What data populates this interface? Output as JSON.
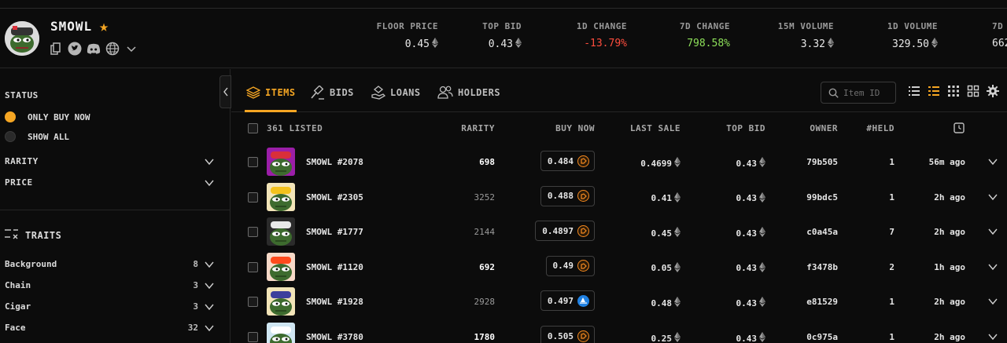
{
  "collection": {
    "name": "SMOWL",
    "favorite": true
  },
  "stats": [
    {
      "label": "FLOOR PRICE",
      "value": "0.45",
      "eth": true,
      "tone": "neutral"
    },
    {
      "label": "TOP BID",
      "value": "0.43",
      "eth": true,
      "tone": "neutral"
    },
    {
      "label": "1D CHANGE",
      "value": "-13.79%",
      "eth": false,
      "tone": "neg"
    },
    {
      "label": "7D CHANGE",
      "value": "798.58%",
      "eth": false,
      "tone": "pos"
    },
    {
      "label": "15M VOLUME",
      "value": "3.32",
      "eth": true,
      "tone": "neutral"
    },
    {
      "label": "1D VOLUME",
      "value": "329.50",
      "eth": true,
      "tone": "neutral"
    },
    {
      "label": "7D",
      "value": "662",
      "eth": false,
      "tone": "neutral"
    }
  ],
  "sidebar": {
    "status_title": "STATUS",
    "status_options": [
      {
        "label": "ONLY BUY NOW",
        "selected": true
      },
      {
        "label": "SHOW ALL",
        "selected": false
      }
    ],
    "filters": [
      {
        "label": "RARITY"
      },
      {
        "label": "PRICE"
      }
    ],
    "traits_title": "TRAITS",
    "traits": [
      {
        "label": "Background",
        "count": "8"
      },
      {
        "label": "Chain",
        "count": "3"
      },
      {
        "label": "Cigar",
        "count": "3"
      },
      {
        "label": "Face",
        "count": "32"
      }
    ]
  },
  "tabs": [
    {
      "label": "ITEMS",
      "active": true,
      "icon": "layers-icon"
    },
    {
      "label": "BIDS",
      "active": false,
      "icon": "gavel-icon"
    },
    {
      "label": "LOANS",
      "active": false,
      "icon": "hand-coin-icon"
    },
    {
      "label": "HOLDERS",
      "active": false,
      "icon": "users-icon"
    }
  ],
  "search": {
    "placeholder": "Item ID"
  },
  "table": {
    "listed_label": "361 LISTED",
    "headers": {
      "rarity": "RARITY",
      "buy_now": "BUY NOW",
      "last_sale": "LAST SALE",
      "top_bid": "TOP BID",
      "owner": "OWNER",
      "held": "#HELD"
    },
    "rows": [
      {
        "name": "SMOWL #2078",
        "rarity": "698",
        "rarity_hi": true,
        "buy_now": "0.484",
        "market": "orange",
        "last_sale": "0.4699",
        "top_bid": "0.43",
        "owner": "79b505",
        "held": "1",
        "time": "56m ago",
        "bg": "#9b1ea8",
        "hat": "#d92f3a"
      },
      {
        "name": "SMOWL #2305",
        "rarity": "3252",
        "rarity_hi": false,
        "buy_now": "0.488",
        "market": "orange",
        "last_sale": "0.41",
        "top_bid": "0.43",
        "owner": "99bdc5",
        "held": "1",
        "time": "2h ago",
        "bg": "#f2e4b8",
        "hat": "#f4c21d"
      },
      {
        "name": "SMOWL #1777",
        "rarity": "2144",
        "rarity_hi": false,
        "buy_now": "0.4897",
        "market": "orange",
        "last_sale": "0.45",
        "top_bid": "0.43",
        "owner": "c0a45a",
        "held": "7",
        "time": "2h ago",
        "bg": "#2b2b2b",
        "hat": "#e8e8e8"
      },
      {
        "name": "SMOWL #1120",
        "rarity": "692",
        "rarity_hi": true,
        "buy_now": "0.49",
        "market": "orange",
        "last_sale": "0.05",
        "top_bid": "0.43",
        "owner": "f3478b",
        "held": "2",
        "time": "1h ago",
        "bg": "#f7d9c8",
        "hat": "#ff4a1c"
      },
      {
        "name": "SMOWL #1928",
        "rarity": "2928",
        "rarity_hi": false,
        "buy_now": "0.497",
        "market": "blue",
        "last_sale": "0.48",
        "top_bid": "0.43",
        "owner": "e81529",
        "held": "1",
        "time": "2h ago",
        "bg": "#f2e4b8",
        "hat": "#3c3f9c"
      },
      {
        "name": "SMOWL #3780",
        "rarity": "1780",
        "rarity_hi": true,
        "buy_now": "0.505",
        "market": "orange",
        "last_sale": "0.25",
        "top_bid": "0.43",
        "owner": "0c975a",
        "held": "1",
        "time": "2h ago",
        "bg": "#cfe6f2",
        "hat": "#ffffff"
      }
    ]
  },
  "colors": {
    "accent": "#f5a623",
    "negative": "#ff4d3d",
    "positive": "#8ee05a"
  }
}
